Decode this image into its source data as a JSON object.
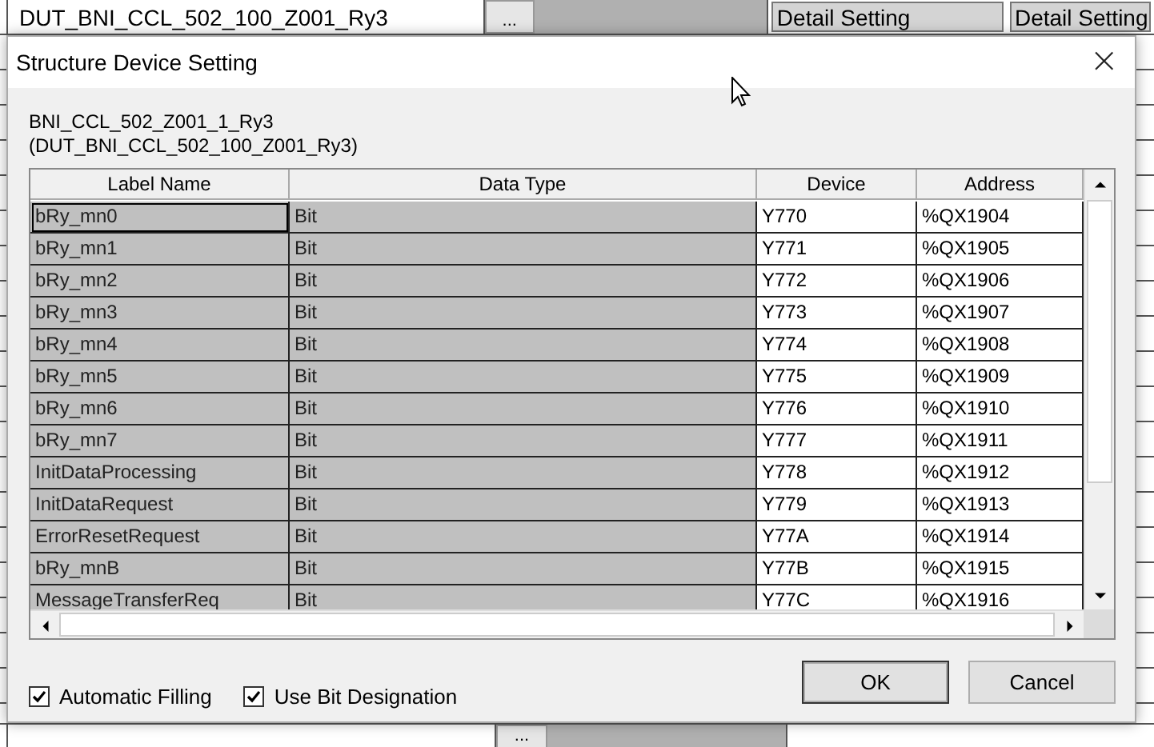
{
  "background_sheet": {
    "top_row": {
      "type_name": "DUT_BNI_CCL_502_100_Z001_Ry3",
      "browse_button": "...",
      "detail_buttons": [
        "Detail Setting",
        "Detail Setting"
      ]
    },
    "bottom_row": {
      "browse_button": "..."
    }
  },
  "dialog": {
    "title": "Structure Device Setting",
    "close_button": "×",
    "structure_name": "BNI_CCL_502_Z001_1_Ry3",
    "structure_type": "(DUT_BNI_CCL_502_100_Z001_Ry3)",
    "columns": [
      "Label Name",
      "Data Type",
      "Device",
      "Address"
    ],
    "rows": [
      {
        "label": "bRy_mn0",
        "data_type": "Bit",
        "device": "Y770",
        "address": "%QX1904",
        "selected": true
      },
      {
        "label": "bRy_mn1",
        "data_type": "Bit",
        "device": "Y771",
        "address": "%QX1905",
        "selected": false
      },
      {
        "label": "bRy_mn2",
        "data_type": "Bit",
        "device": "Y772",
        "address": "%QX1906",
        "selected": false
      },
      {
        "label": "bRy_mn3",
        "data_type": "Bit",
        "device": "Y773",
        "address": "%QX1907",
        "selected": false
      },
      {
        "label": "bRy_mn4",
        "data_type": "Bit",
        "device": "Y774",
        "address": "%QX1908",
        "selected": false
      },
      {
        "label": "bRy_mn5",
        "data_type": "Bit",
        "device": "Y775",
        "address": "%QX1909",
        "selected": false
      },
      {
        "label": "bRy_mn6",
        "data_type": "Bit",
        "device": "Y776",
        "address": "%QX1910",
        "selected": false
      },
      {
        "label": "bRy_mn7",
        "data_type": "Bit",
        "device": "Y777",
        "address": "%QX1911",
        "selected": false
      },
      {
        "label": "InitDataProcessing",
        "data_type": "Bit",
        "device": "Y778",
        "address": "%QX1912",
        "selected": false
      },
      {
        "label": "InitDataRequest",
        "data_type": "Bit",
        "device": "Y779",
        "address": "%QX1913",
        "selected": false
      },
      {
        "label": "ErrorResetRequest",
        "data_type": "Bit",
        "device": "Y77A",
        "address": "%QX1914",
        "selected": false
      },
      {
        "label": "bRy_mnB",
        "data_type": "Bit",
        "device": "Y77B",
        "address": "%QX1915",
        "selected": false
      },
      {
        "label": "MessageTransferReq",
        "data_type": "Bit",
        "device": "Y77C",
        "address": "%QX1916",
        "selected": false
      }
    ],
    "checkboxes": [
      {
        "label": "Automatic Filling",
        "checked": true
      },
      {
        "label": "Use Bit Designation",
        "checked": true
      }
    ],
    "buttons": [
      "OK",
      "Cancel"
    ]
  }
}
